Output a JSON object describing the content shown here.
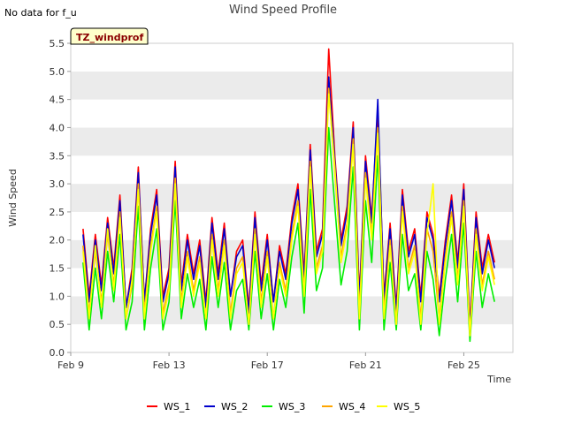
{
  "page": {
    "note": "No data for f_u",
    "badge": "TZ_windprof"
  },
  "colors": {
    "band": "#ebebeb",
    "WS_1": "#ff0000",
    "WS_2": "#0000cc",
    "WS_3": "#00ee00",
    "WS_4": "#ffa500",
    "WS_5": "#ffff00",
    "badge_fill": "#ffffcc"
  },
  "chart_data": {
    "type": "line",
    "title": "Wind Speed Profile",
    "xlabel": "Time",
    "ylabel": "Wind Speed",
    "xlim": [
      "2023-02-09",
      "2023-02-27"
    ],
    "ylim": [
      0.0,
      5.5
    ],
    "yticks": [
      "0.0",
      "0.5",
      "1.0",
      "1.5",
      "2.0",
      "2.5",
      "3.0",
      "3.5",
      "4.0",
      "4.5",
      "5.0",
      "5.5"
    ],
    "xticks": [
      {
        "date": "2023-02-09",
        "label": "Feb 9"
      },
      {
        "date": "2023-02-13",
        "label": "Feb 13"
      },
      {
        "date": "2023-02-17",
        "label": "Feb 17"
      },
      {
        "date": "2023-02-21",
        "label": "Feb 21"
      },
      {
        "date": "2023-02-25",
        "label": "Feb 25"
      }
    ],
    "grid": "alternating horizontal bands",
    "legend_position": "bottom",
    "series_names": [
      "WS_1",
      "WS_2",
      "WS_3",
      "WS_4",
      "WS_5"
    ],
    "x": [
      "2023-02-09 12:00",
      "2023-02-09 18:00",
      "2023-02-10 00:00",
      "2023-02-10 06:00",
      "2023-02-10 12:00",
      "2023-02-10 18:00",
      "2023-02-11 00:00",
      "2023-02-11 06:00",
      "2023-02-11 12:00",
      "2023-02-11 18:00",
      "2023-02-12 00:00",
      "2023-02-12 06:00",
      "2023-02-12 12:00",
      "2023-02-12 18:00",
      "2023-02-13 00:00",
      "2023-02-13 06:00",
      "2023-02-13 12:00",
      "2023-02-13 18:00",
      "2023-02-14 00:00",
      "2023-02-14 06:00",
      "2023-02-14 12:00",
      "2023-02-14 18:00",
      "2023-02-15 00:00",
      "2023-02-15 06:00",
      "2023-02-15 12:00",
      "2023-02-15 18:00",
      "2023-02-16 00:00",
      "2023-02-16 06:00",
      "2023-02-16 12:00",
      "2023-02-16 18:00",
      "2023-02-17 00:00",
      "2023-02-17 06:00",
      "2023-02-17 12:00",
      "2023-02-17 18:00",
      "2023-02-18 00:00",
      "2023-02-18 06:00",
      "2023-02-18 12:00",
      "2023-02-18 18:00",
      "2023-02-19 00:00",
      "2023-02-19 06:00",
      "2023-02-19 12:00",
      "2023-02-19 18:00",
      "2023-02-20 00:00",
      "2023-02-20 06:00",
      "2023-02-20 12:00",
      "2023-02-20 18:00",
      "2023-02-21 00:00",
      "2023-02-21 06:00",
      "2023-02-21 12:00",
      "2023-02-21 18:00",
      "2023-02-22 00:00",
      "2023-02-22 06:00",
      "2023-02-22 12:00",
      "2023-02-22 18:00",
      "2023-02-23 00:00",
      "2023-02-23 06:00",
      "2023-02-23 12:00",
      "2023-02-23 18:00",
      "2023-02-24 00:00",
      "2023-02-24 06:00",
      "2023-02-24 12:00",
      "2023-02-24 18:00",
      "2023-02-25 00:00",
      "2023-02-25 06:00",
      "2023-02-25 12:00",
      "2023-02-25 18:00",
      "2023-02-26 00:00",
      "2023-02-26 06:00"
    ],
    "series": [
      {
        "name": "WS_1",
        "values": [
          2.2,
          1.0,
          2.1,
          1.2,
          2.4,
          1.5,
          2.8,
          0.8,
          1.5,
          3.3,
          0.9,
          2.2,
          2.9,
          1.0,
          1.5,
          3.4,
          1.2,
          2.1,
          1.4,
          2.0,
          0.9,
          2.4,
          1.4,
          2.3,
          1.0,
          1.8,
          2.0,
          0.8,
          2.5,
          1.2,
          2.1,
          0.9,
          1.9,
          1.4,
          2.4,
          3.0,
          1.4,
          3.7,
          1.8,
          2.2,
          5.4,
          3.5,
          2.0,
          2.6,
          4.1,
          1.0,
          3.5,
          2.4,
          4.3,
          1.0,
          2.3,
          0.8,
          2.9,
          1.8,
          2.2,
          1.0,
          2.5,
          2.1,
          1.0,
          2.0,
          2.8,
          1.6,
          3.0,
          0.5,
          2.5,
          1.5,
          2.1,
          1.6
        ]
      },
      {
        "name": "WS_2",
        "values": [
          2.1,
          0.9,
          2.0,
          1.1,
          2.3,
          1.4,
          2.7,
          0.8,
          1.4,
          3.2,
          0.9,
          2.1,
          2.8,
          0.9,
          1.4,
          3.3,
          1.1,
          2.0,
          1.3,
          1.9,
          0.8,
          2.3,
          1.3,
          2.2,
          1.0,
          1.7,
          1.9,
          0.7,
          2.4,
          1.1,
          2.0,
          0.9,
          1.8,
          1.3,
          2.3,
          2.9,
          1.3,
          3.6,
          1.7,
          2.1,
          4.9,
          3.4,
          1.9,
          2.5,
          4.0,
          0.9,
          3.4,
          2.3,
          4.5,
          0.9,
          2.2,
          0.7,
          2.8,
          1.7,
          2.1,
          0.9,
          2.4,
          2.0,
          0.9,
          1.9,
          2.7,
          1.5,
          2.9,
          0.4,
          2.4,
          1.4,
          2.0,
          1.5
        ]
      },
      {
        "name": "WS_3",
        "values": [
          1.6,
          0.4,
          1.5,
          0.6,
          1.8,
          0.9,
          2.1,
          0.4,
          0.9,
          2.6,
          0.4,
          1.5,
          2.2,
          0.4,
          0.9,
          2.7,
          0.6,
          1.4,
          0.8,
          1.3,
          0.4,
          1.7,
          0.8,
          1.6,
          0.4,
          1.1,
          1.3,
          0.4,
          1.8,
          0.6,
          1.4,
          0.4,
          1.3,
          0.8,
          1.7,
          2.3,
          0.7,
          2.9,
          1.1,
          1.5,
          4.0,
          2.6,
          1.2,
          1.8,
          3.3,
          0.4,
          2.7,
          1.6,
          3.5,
          0.4,
          1.6,
          0.4,
          2.1,
          1.1,
          1.4,
          0.4,
          1.8,
          1.3,
          0.3,
          1.3,
          2.1,
          0.9,
          2.3,
          0.2,
          1.8,
          0.8,
          1.4,
          0.9
        ]
      },
      {
        "name": "WS_4",
        "values": [
          1.9,
          0.7,
          1.8,
          0.9,
          2.1,
          1.2,
          2.5,
          0.6,
          1.2,
          3.0,
          0.7,
          1.9,
          2.6,
          0.7,
          1.2,
          3.1,
          0.9,
          1.8,
          1.1,
          1.7,
          0.6,
          2.1,
          1.1,
          2.0,
          0.7,
          1.5,
          1.7,
          0.5,
          2.2,
          0.9,
          1.8,
          0.6,
          1.6,
          1.1,
          2.1,
          2.7,
          1.1,
          3.4,
          1.5,
          1.9,
          4.7,
          3.2,
          1.7,
          2.3,
          3.8,
          0.7,
          3.2,
          2.1,
          4.0,
          0.7,
          2.0,
          0.5,
          2.6,
          1.5,
          1.9,
          0.6,
          2.2,
          1.8,
          0.6,
          1.7,
          2.5,
          1.3,
          2.7,
          0.3,
          2.2,
          1.2,
          1.8,
          1.3
        ]
      },
      {
        "name": "WS_5",
        "values": [
          1.8,
          0.6,
          1.9,
          0.8,
          2.2,
          1.1,
          2.4,
          0.6,
          1.3,
          2.9,
          0.6,
          1.8,
          2.5,
          0.6,
          1.1,
          3.0,
          0.8,
          1.7,
          1.0,
          1.6,
          0.6,
          2.0,
          1.0,
          1.9,
          0.6,
          1.4,
          1.6,
          0.5,
          2.1,
          0.8,
          1.7,
          0.6,
          1.5,
          1.0,
          2.0,
          2.6,
          1.0,
          3.3,
          1.4,
          1.8,
          4.6,
          3.3,
          1.6,
          2.2,
          3.7,
          0.6,
          3.1,
          2.0,
          3.9,
          0.6,
          1.9,
          0.5,
          2.5,
          1.4,
          1.8,
          0.5,
          2.1,
          3.0,
          0.5,
          1.6,
          2.4,
          1.2,
          2.6,
          0.3,
          2.1,
          1.1,
          1.7,
          1.2
        ]
      }
    ]
  }
}
